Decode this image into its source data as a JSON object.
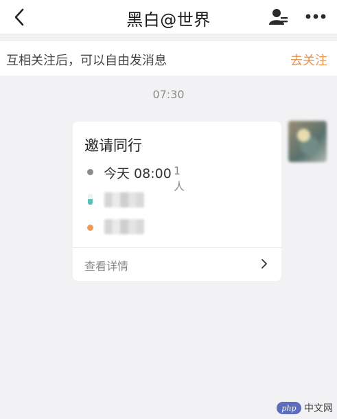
{
  "header": {
    "title": "黑白@世界",
    "back_icon": "chevron-left-icon",
    "profile_icon": "user-profile-icon",
    "more_icon": "more-horizontal-icon"
  },
  "follow_bar": {
    "text": "互相关注后，可以自由发消息",
    "action_label": "去关注",
    "action_color": "#e8924a"
  },
  "message": {
    "timestamp": "07:30",
    "card": {
      "title": "邀请同行",
      "time": "今天 08:00",
      "count": "1人",
      "details_label": "查看详情"
    }
  },
  "watermark": {
    "badge": "php",
    "text": "中文网"
  }
}
